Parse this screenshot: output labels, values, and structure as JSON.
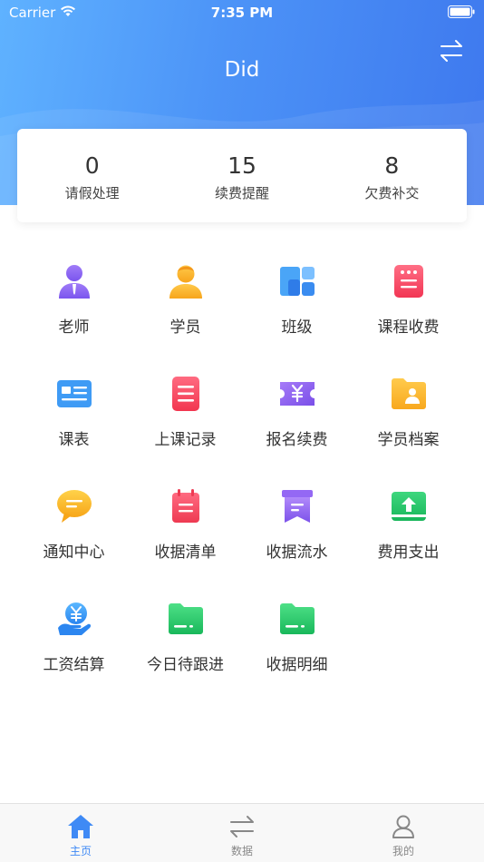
{
  "status_bar": {
    "carrier": "Carrier",
    "time": "7:35 PM"
  },
  "header": {
    "title": "Did"
  },
  "stats": [
    {
      "value": "0",
      "label": "请假处理"
    },
    {
      "value": "15",
      "label": "续费提醒"
    },
    {
      "value": "8",
      "label": "欠费补交"
    }
  ],
  "menu": [
    {
      "label": "老师",
      "icon": "teacher-icon"
    },
    {
      "label": "学员",
      "icon": "student-icon"
    },
    {
      "label": "班级",
      "icon": "class-icon"
    },
    {
      "label": "课程收费",
      "icon": "course-fee-icon"
    },
    {
      "label": "课表",
      "icon": "schedule-icon"
    },
    {
      "label": "上课记录",
      "icon": "class-record-icon"
    },
    {
      "label": "报名续费",
      "icon": "enroll-renew-icon"
    },
    {
      "label": "学员档案",
      "icon": "student-file-icon"
    },
    {
      "label": "通知中心",
      "icon": "notification-icon"
    },
    {
      "label": "收据清单",
      "icon": "receipt-list-icon"
    },
    {
      "label": "收据流水",
      "icon": "receipt-flow-icon"
    },
    {
      "label": "费用支出",
      "icon": "expense-icon"
    },
    {
      "label": "工资结算",
      "icon": "salary-icon"
    },
    {
      "label": "今日待跟进",
      "icon": "followup-icon"
    },
    {
      "label": "收据明细",
      "icon": "receipt-detail-icon"
    }
  ],
  "tabbar": [
    {
      "label": "主页",
      "icon": "home-icon",
      "active": true
    },
    {
      "label": "数据",
      "icon": "data-icon",
      "active": false
    },
    {
      "label": "我的",
      "icon": "profile-icon",
      "active": false
    }
  ],
  "colors": {
    "accent": "#3f8af5",
    "header_start": "#5fb2ff",
    "header_end": "#3e78ee"
  }
}
